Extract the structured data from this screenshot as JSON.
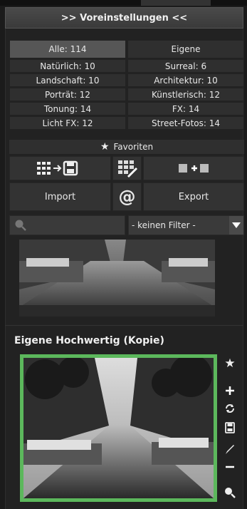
{
  "header": {
    "title": ">> Voreinstellungen <<"
  },
  "categories": [
    [
      {
        "label": "Alle: 114",
        "active": true
      },
      {
        "label": "Eigene",
        "active": false
      }
    ],
    [
      {
        "label": "Natürlich: 10"
      },
      {
        "label": "Surreal: 6"
      }
    ],
    [
      {
        "label": "Landschaft: 10"
      },
      {
        "label": "Architektur: 10"
      }
    ],
    [
      {
        "label": "Porträt: 12"
      },
      {
        "label": "Künstlerisch: 12"
      }
    ],
    [
      {
        "label": "Tonung: 14"
      },
      {
        "label": "FX: 14"
      }
    ],
    [
      {
        "label": "Licht FX: 12"
      },
      {
        "label": "Street-Fotos: 14"
      }
    ]
  ],
  "favorites": {
    "label": "Favoriten",
    "icon": "star-icon"
  },
  "tools": {
    "icons": [
      "grid-to-save-icon",
      "grid-edit-icon",
      "add-preset-icon"
    ]
  },
  "io": {
    "import_label": "Import",
    "at_label": "@",
    "export_label": "Export"
  },
  "filter": {
    "selected": "- keinen Filter -",
    "search_icon": "search-icon"
  },
  "section": {
    "title": "Eigene Hochwertig (Kopie)"
  },
  "side_icons": [
    "star-icon",
    "plus-icon",
    "sync-icon",
    "save-icon",
    "brush-icon",
    "minus-icon",
    "zoom-icon"
  ],
  "colors": {
    "accent_frame": "#5cb85c",
    "active_button": "#565656"
  }
}
